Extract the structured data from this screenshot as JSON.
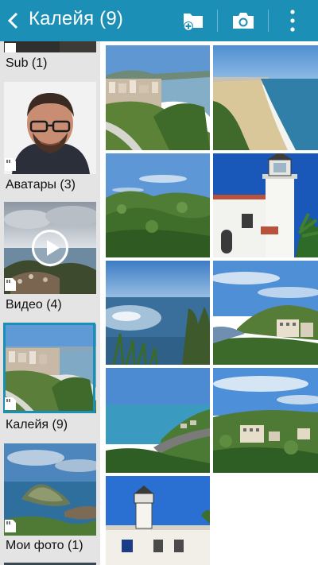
{
  "header": {
    "title": "Калейя (9)",
    "back_icon": "chevron-left-icon",
    "actions": [
      {
        "icon": "new-folder-icon"
      },
      {
        "icon": "camera-icon"
      },
      {
        "icon": "more-vertical-icon"
      }
    ],
    "color": "#1b8fb6"
  },
  "albums": [
    {
      "label": "Sub (1)"
    },
    {
      "label": "Аватары (3)"
    },
    {
      "label": "Видео (4)"
    },
    {
      "label": "Калейя (9)",
      "selected": true
    },
    {
      "label": "Мои фото (1)"
    }
  ],
  "photos": [
    {
      "subject": "city-coast"
    },
    {
      "subject": "beach"
    },
    {
      "subject": "green-hills"
    },
    {
      "subject": "lighthouse"
    },
    {
      "subject": "sea-sunlight"
    },
    {
      "subject": "hillside-town"
    },
    {
      "subject": "coastal-road"
    },
    {
      "subject": "hillside-houses"
    },
    {
      "subject": "lighthouse-tower"
    }
  ]
}
